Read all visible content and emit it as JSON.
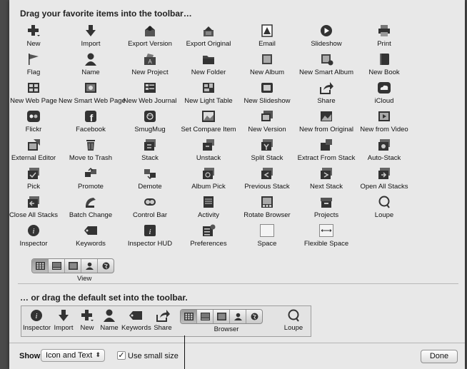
{
  "header": {
    "title": "Drag your favorite items into the toolbar…"
  },
  "items": [
    {
      "label": "New",
      "icon": "plus-icon"
    },
    {
      "label": "Import",
      "icon": "download-arrow-icon"
    },
    {
      "label": "Export Version",
      "icon": "export-version-icon"
    },
    {
      "label": "Export Original",
      "icon": "export-original-icon"
    },
    {
      "label": "Email",
      "icon": "email-icon"
    },
    {
      "label": "Slideshow",
      "icon": "play-icon"
    },
    {
      "label": "Print",
      "icon": "printer-icon"
    },
    {
      "label": "Flag",
      "icon": "flag-icon"
    },
    {
      "label": "Name",
      "icon": "person-icon"
    },
    {
      "label": "New Project",
      "icon": "new-project-icon"
    },
    {
      "label": "New Folder",
      "icon": "folder-icon"
    },
    {
      "label": "New Album",
      "icon": "album-icon"
    },
    {
      "label": "New Smart Album",
      "icon": "smart-album-icon"
    },
    {
      "label": "New Book",
      "icon": "book-icon"
    },
    {
      "label": "New Web Page",
      "icon": "web-page-icon"
    },
    {
      "label": "New Smart Web Page",
      "icon": "smart-web-page-icon"
    },
    {
      "label": "New Web Journal",
      "icon": "web-journal-icon"
    },
    {
      "label": "New Light Table",
      "icon": "light-table-icon"
    },
    {
      "label": "New Slideshow",
      "icon": "slideshow-icon"
    },
    {
      "label": "Share",
      "icon": "share-icon"
    },
    {
      "label": "iCloud",
      "icon": "cloud-icon"
    },
    {
      "label": "Flickr",
      "icon": "flickr-icon"
    },
    {
      "label": "Facebook",
      "icon": "facebook-icon"
    },
    {
      "label": "SmugMug",
      "icon": "smugmug-icon"
    },
    {
      "label": "Set Compare Item",
      "icon": "compare-icon"
    },
    {
      "label": "New Version",
      "icon": "new-version-icon"
    },
    {
      "label": "New from Original",
      "icon": "new-from-original-icon"
    },
    {
      "label": "New from Video",
      "icon": "video-icon"
    },
    {
      "label": "External Editor",
      "icon": "external-editor-icon"
    },
    {
      "label": "Move to Trash",
      "icon": "trash-icon"
    },
    {
      "label": "Stack",
      "icon": "stack-icon"
    },
    {
      "label": "Unstack",
      "icon": "unstack-icon"
    },
    {
      "label": "Split Stack",
      "icon": "split-stack-icon"
    },
    {
      "label": "Extract From Stack",
      "icon": "extract-stack-icon"
    },
    {
      "label": "Auto-Stack",
      "icon": "auto-stack-icon"
    },
    {
      "label": "Pick",
      "icon": "pick-icon"
    },
    {
      "label": "Promote",
      "icon": "promote-icon"
    },
    {
      "label": "Demote",
      "icon": "demote-icon"
    },
    {
      "label": "Album Pick",
      "icon": "album-pick-icon"
    },
    {
      "label": "Previous Stack",
      "icon": "previous-stack-icon"
    },
    {
      "label": "Next Stack",
      "icon": "next-stack-icon"
    },
    {
      "label": "Open All Stacks",
      "icon": "open-stacks-icon"
    },
    {
      "label": "Close All Stacks",
      "icon": "close-stacks-icon"
    },
    {
      "label": "Batch Change",
      "icon": "batch-change-icon"
    },
    {
      "label": "Control Bar",
      "icon": "control-bar-icon"
    },
    {
      "label": "Activity",
      "icon": "activity-icon"
    },
    {
      "label": "Rotate Browser",
      "icon": "rotate-browser-icon"
    },
    {
      "label": "Projects",
      "icon": "projects-icon"
    },
    {
      "label": "Loupe",
      "icon": "loupe-icon"
    },
    {
      "label": "Inspector",
      "icon": "info-icon"
    },
    {
      "label": "Keywords",
      "icon": "tag-icon"
    },
    {
      "label": "Inspector HUD",
      "icon": "info-hud-icon"
    },
    {
      "label": "Preferences",
      "icon": "preferences-icon"
    },
    {
      "label": "Space",
      "icon": "space-icon"
    },
    {
      "label": "Flexible Space",
      "icon": "flexible-space-icon"
    }
  ],
  "view": {
    "label": "View",
    "buttons": [
      "grid",
      "filmstrip",
      "viewer",
      "faces",
      "places"
    ]
  },
  "default_set": {
    "title": "… or drag the default set into the toolbar.",
    "items": [
      {
        "label": "Inspector"
      },
      {
        "label": "Import"
      },
      {
        "label": "New"
      },
      {
        "label": "Name"
      },
      {
        "label": "Keywords"
      },
      {
        "label": "Share"
      }
    ],
    "browser_label": "Browser",
    "loupe_label": "Loupe"
  },
  "footer": {
    "show_label": "Show",
    "show_value": "Icon and Text",
    "small_size_label": "Use small size",
    "small_size_checked": true,
    "done_label": "Done"
  }
}
